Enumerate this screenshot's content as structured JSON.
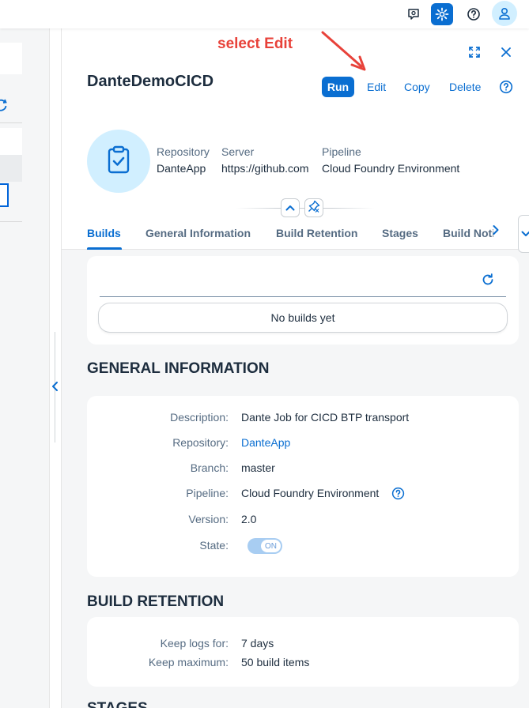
{
  "shell": {
    "icons": [
      "feedback-icon",
      "settings-icon",
      "help-icon",
      "user-icon"
    ]
  },
  "annotation": {
    "text": "select Edit"
  },
  "header": {
    "title": "DanteDemoCICD",
    "actions": {
      "run": "Run",
      "edit": "Edit",
      "copy": "Copy",
      "delete": "Delete"
    },
    "attributes": [
      {
        "label": "Repository",
        "value": "DanteApp"
      },
      {
        "label": "Server",
        "value": "https://github.com"
      },
      {
        "label": "Pipeline",
        "value": "Cloud Foundry Environment"
      }
    ]
  },
  "tabs": [
    {
      "label": "Builds",
      "selected": true
    },
    {
      "label": "General Information",
      "selected": false
    },
    {
      "label": "Build Retention",
      "selected": false
    },
    {
      "label": "Stages",
      "selected": false
    },
    {
      "label": "Build Notifications",
      "selected": false
    }
  ],
  "builds": {
    "empty_text": "No builds yet"
  },
  "general_information": {
    "title": "GENERAL INFORMATION",
    "fields": [
      {
        "label": "Description:",
        "value": "Dante Job for CICD BTP transport"
      },
      {
        "label": "Repository:",
        "value": "DanteApp"
      },
      {
        "label": "Branch:",
        "value": "master"
      },
      {
        "label": "Pipeline:",
        "value": "Cloud Foundry Environment"
      },
      {
        "label": "Version:",
        "value": "2.0"
      },
      {
        "label": "State:",
        "value": "ON"
      }
    ]
  },
  "build_retention": {
    "title": "BUILD RETENTION",
    "fields": [
      {
        "label": "Keep logs for:",
        "value": "7 days"
      },
      {
        "label": "Keep maximum:",
        "value": "50 build items"
      }
    ]
  },
  "stages": {
    "title": "STAGES"
  },
  "colors": {
    "accent": "#0a6ed1",
    "annotation": "#e8423a"
  }
}
